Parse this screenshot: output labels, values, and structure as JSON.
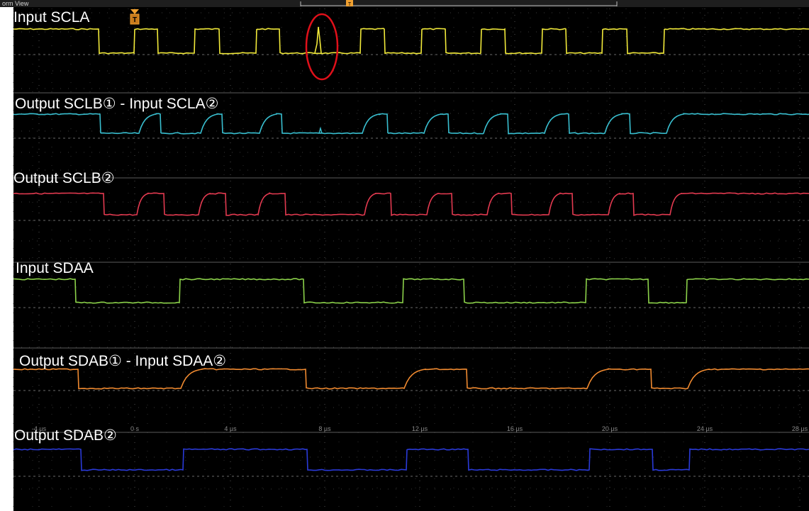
{
  "window": {
    "title": "orm View"
  },
  "trigger_marker": "T",
  "colors": {
    "background": "#000000",
    "grid_dot": "#505050",
    "divider": "#5c5c5c",
    "annotation": "#e0101a",
    "marker": "#f0a030"
  },
  "time_axis": {
    "unit": "µs",
    "ticks": [
      "-4 µs",
      "0 s",
      "4 µs",
      "8 µs",
      "12 µs",
      "16 µs",
      "20 µs",
      "24 µs",
      "28 µs"
    ]
  },
  "channels": [
    {
      "id": "scla",
      "label": "Input SCLA",
      "color": "#f2ea3a"
    },
    {
      "id": "sclb1",
      "label": "Output SCLB① - Input SCLA②",
      "color": "#39bfd0"
    },
    {
      "id": "sclb2",
      "label": "Output SCLB②",
      "color": "#e33a50"
    },
    {
      "id": "sdaa",
      "label": "Input SDAA",
      "color": "#8cd24a"
    },
    {
      "id": "sdab1",
      "label": "Output SDAB① - Input SDAA②",
      "color": "#f08a30"
    },
    {
      "id": "sdab2",
      "label": "Output SDAB②",
      "color": "#2a3ad8"
    }
  ],
  "annotation": {
    "name": "glitch-highlight",
    "description": ""
  }
}
